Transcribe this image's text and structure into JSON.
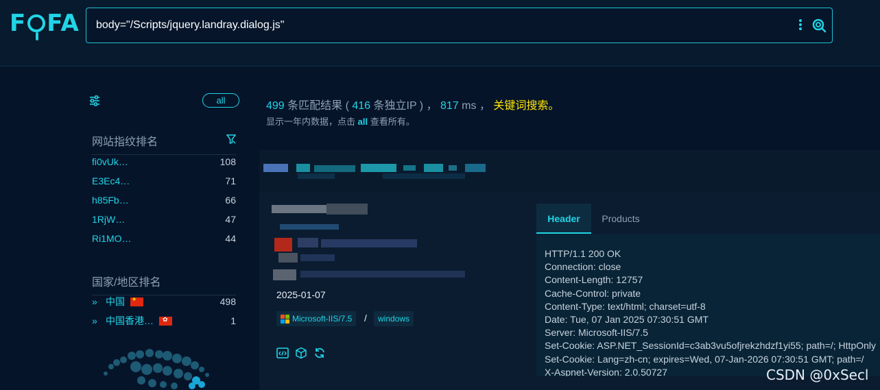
{
  "brand": {
    "logo_text_left": "F",
    "logo_text_right": "FA"
  },
  "search": {
    "query": "body=\"/Scripts/jquery.landray.dialog.js\""
  },
  "sidebar": {
    "all_label": "all",
    "fingerprint_title": "网站指纹排名",
    "fingerprints": [
      {
        "name": "fi0vUk…",
        "count": "108"
      },
      {
        "name": "E3Ec4…",
        "count": "71"
      },
      {
        "name": "h85Fb…",
        "count": "66"
      },
      {
        "name": "1RjW…",
        "count": "47"
      },
      {
        "name": "Ri1MO…",
        "count": "44"
      }
    ],
    "country_title": "国家/地区排名",
    "countries": [
      {
        "name": "中国",
        "count": "498"
      },
      {
        "name": "中国香港…",
        "count": "1"
      }
    ]
  },
  "summary": {
    "matches": "499",
    "matches_label": " 条匹配结果 ( ",
    "unique_ip": "416",
    "unique_ip_label": " 条独立IP ) ， ",
    "ms": "817",
    "ms_label": " ms ， ",
    "keyword_search": "关键词搜索。",
    "note_prefix": "显示一年内数据，点击 ",
    "note_all": "all",
    "note_suffix": " 查看所有。"
  },
  "result": {
    "date": "2025-01-07",
    "server_tag": "Microsoft-IIS/7.5",
    "separator": "/",
    "os_tag": "windows",
    "tabs": {
      "header": "Header",
      "products": "Products"
    },
    "header_lines": [
      "HTTP/1.1 200 OK",
      "Connection: close",
      "Content-Length: 12757",
      "Cache-Control: private",
      "Content-Type: text/html; charset=utf-8",
      "Date: Tue, 07 Jan 2025 07:30:51 GMT",
      "Server: Microsoft-IIS/7.5",
      "Set-Cookie: ASP.NET_SessionId=c3ab3vu5ofjrekzhdzf1yi55; path=/; HttpOnly",
      "Set-Cookie: Lang=zh-cn; expires=Wed, 07-Jan-2026 07:30:51 GMT; path=/",
      "X-Aspnet-Version: 2.0.50727"
    ]
  },
  "watermark": "CSDN @0xSecl",
  "colors": {
    "accent": "#21d5e6",
    "keyword": "#ffe500",
    "background": "#06142a"
  }
}
